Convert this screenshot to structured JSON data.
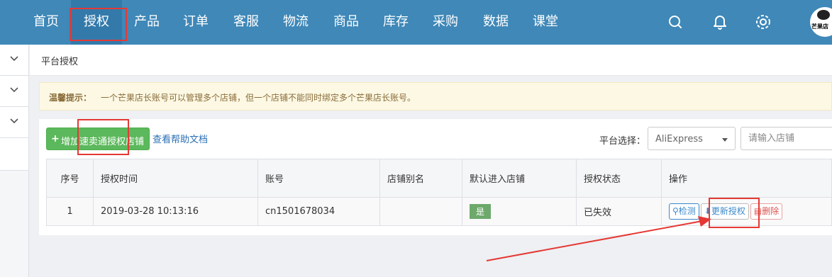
{
  "topnav": {
    "items": [
      "首页",
      "授权",
      "产品",
      "订单",
      "客服",
      "物流",
      "商品",
      "库存",
      "采购",
      "数据",
      "课堂"
    ],
    "active_index": 1,
    "icons": [
      "search-icon",
      "bell-icon",
      "settings-icon"
    ],
    "avatar_text": "芒果店"
  },
  "breadcrumb": {
    "title": "平台授权"
  },
  "tip": {
    "label": "温馨提示：",
    "text": "一个芒果店长账号可以管理多个店铺，但一个店铺不能同时绑定多个芒果店长账号。"
  },
  "toolbar": {
    "add_button": "增加速卖通授权店铺",
    "help_link": "查看帮助文档",
    "platform_label": "平台选择：",
    "platform_value": "AliExpress",
    "shop_placeholder": "请输入店铺"
  },
  "table": {
    "headers": [
      "序号",
      "授权时间",
      "账号",
      "店铺别名",
      "默认进入店铺",
      "授权状态",
      "操作"
    ],
    "rows": [
      {
        "index": "1",
        "auth_time": "2019-03-28 10:13:16",
        "account": "cn1501678034",
        "alias": "",
        "default_shop": "是",
        "status": "已失效",
        "actions": [
          "检测",
          "更新授权",
          "删除"
        ]
      }
    ]
  },
  "colors": {
    "nav_bg": "#3f88b8",
    "add_button": "#5cb85c",
    "annotation": "#e53935"
  }
}
